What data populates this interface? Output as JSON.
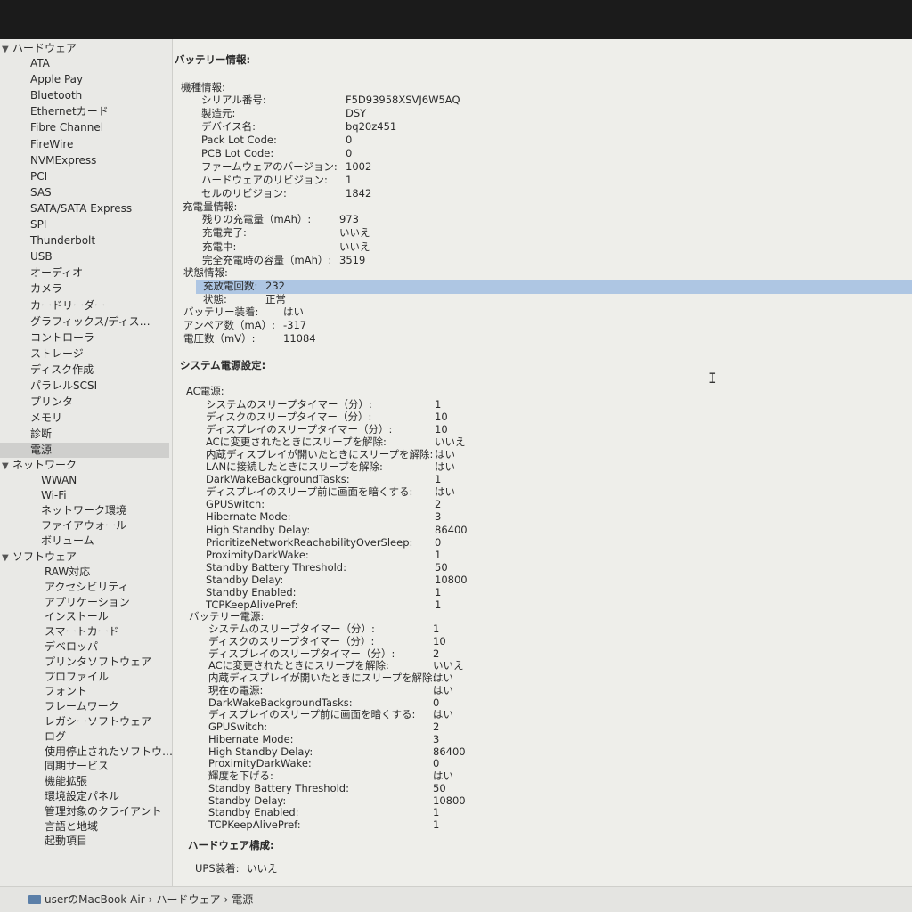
{
  "sidebar": {
    "groups": [
      {
        "label": "ハードウェア",
        "items": [
          "ATA",
          "Apple Pay",
          "Bluetooth",
          "Ethernetカード",
          "Fibre Channel",
          "FireWire",
          "NVMExpress",
          "PCI",
          "SAS",
          "SATA/SATA Express",
          "SPI",
          "Thunderbolt",
          "USB",
          "オーディオ",
          "カメラ",
          "カードリーダー",
          "グラフィックス/ディス…",
          "コントローラ",
          "ストレージ",
          "ディスク作成",
          "パラレルSCSI",
          "プリンタ",
          "メモリ",
          "診断",
          "電源"
        ]
      },
      {
        "label": "ネットワーク",
        "items": [
          "WWAN",
          "Wi-Fi",
          "ネットワーク環境",
          "ファイアウォール",
          "ボリューム"
        ]
      },
      {
        "label": "ソフトウェア",
        "items": [
          "RAW対応",
          "アクセシビリティ",
          "アプリケーション",
          "インストール",
          "スマートカード",
          "デベロッパ",
          "プリンタソフトウェア",
          "プロファイル",
          "フォント",
          "フレームワーク",
          "レガシーソフトウェア",
          "ログ",
          "使用停止されたソフトウ…",
          "同期サービス",
          "機能拡張",
          "環境設定パネル",
          "管理対象のクライアント",
          "言語と地域",
          "起動項目"
        ]
      }
    ],
    "selected": "電源"
  },
  "battery": {
    "title": "バッテリー情報:",
    "model_header": "機種情報:",
    "model": [
      {
        "k": "シリアル番号:",
        "v": "F5D93958XSVJ6W5AQ"
      },
      {
        "k": "製造元:",
        "v": "DSY"
      },
      {
        "k": "デバイス名:",
        "v": "bq20z451"
      },
      {
        "k": "Pack Lot Code:",
        "v": "0"
      },
      {
        "k": "PCB Lot Code:",
        "v": "0"
      },
      {
        "k": "ファームウェアのバージョン:",
        "v": "1002"
      },
      {
        "k": "ハードウェアのリビジョン:",
        "v": "1"
      },
      {
        "k": "セルのリビジョン:",
        "v": "1842"
      }
    ],
    "charge_header": "充電量情報:",
    "charge": [
      {
        "k": "残りの充電量（mAh）:",
        "v": "973"
      },
      {
        "k": "充電完了:",
        "v": "いいえ"
      },
      {
        "k": "充電中:",
        "v": "いいえ"
      },
      {
        "k": "完全充電時の容量（mAh）:",
        "v": "3519"
      }
    ],
    "health_header": "状態情報:",
    "health": [
      {
        "k": "充放電回数:",
        "v": "232"
      },
      {
        "k": "状態:",
        "v": "正常"
      }
    ],
    "misc": [
      {
        "k": "バッテリー装着:",
        "v": "はい"
      },
      {
        "k": "アンペア数（mA）:",
        "v": "-317"
      },
      {
        "k": "電圧数（mV）:",
        "v": "11084"
      }
    ]
  },
  "power": {
    "title": "システム電源設定:",
    "ac_header": "AC電源:",
    "ac": [
      {
        "k": "システムのスリープタイマー（分）:",
        "v": "1"
      },
      {
        "k": "ディスクのスリープタイマー（分）:",
        "v": "10"
      },
      {
        "k": "ディスプレイのスリープタイマー（分）:",
        "v": "10"
      },
      {
        "k": "ACに変更されたときにスリープを解除:",
        "v": "いいえ"
      },
      {
        "k": "内蔵ディスプレイが開いたときにスリープを解除:",
        "v": "はい"
      },
      {
        "k": "LANに接続したときにスリープを解除:",
        "v": "はい"
      },
      {
        "k": "DarkWakeBackgroundTasks:",
        "v": "1"
      },
      {
        "k": "ディスプレイのスリープ前に画面を暗くする:",
        "v": "はい"
      },
      {
        "k": "GPUSwitch:",
        "v": "2"
      },
      {
        "k": "Hibernate Mode:",
        "v": "3"
      },
      {
        "k": "High Standby Delay:",
        "v": "86400"
      },
      {
        "k": "PrioritizeNetworkReachabilityOverSleep:",
        "v": "0"
      },
      {
        "k": "ProximityDarkWake:",
        "v": "1"
      },
      {
        "k": "Standby Battery Threshold:",
        "v": "50"
      },
      {
        "k": "Standby Delay:",
        "v": "10800"
      },
      {
        "k": "Standby Enabled:",
        "v": "1"
      },
      {
        "k": "TCPKeepAlivePref:",
        "v": "1"
      }
    ],
    "battery_header": "バッテリー電源:",
    "battery": [
      {
        "k": "システムのスリープタイマー（分）:",
        "v": "1"
      },
      {
        "k": "ディスクのスリープタイマー（分）:",
        "v": "10"
      },
      {
        "k": "ディスプレイのスリープタイマー（分）:",
        "v": "2"
      },
      {
        "k": "ACに変更されたときにスリープを解除:",
        "v": "いいえ"
      },
      {
        "k": "内蔵ディスプレイが開いたときにスリープを解除:",
        "v": "はい"
      },
      {
        "k": "現在の電源:",
        "v": "はい"
      },
      {
        "k": "DarkWakeBackgroundTasks:",
        "v": "0"
      },
      {
        "k": "ディスプレイのスリープ前に画面を暗くする:",
        "v": "はい"
      },
      {
        "k": "GPUSwitch:",
        "v": "2"
      },
      {
        "k": "Hibernate Mode:",
        "v": "3"
      },
      {
        "k": "High Standby Delay:",
        "v": "86400"
      },
      {
        "k": "ProximityDarkWake:",
        "v": "0"
      },
      {
        "k": "輝度を下げる:",
        "v": "はい"
      },
      {
        "k": "Standby Battery Threshold:",
        "v": "50"
      },
      {
        "k": "Standby Delay:",
        "v": "10800"
      },
      {
        "k": "Standby Enabled:",
        "v": "1"
      },
      {
        "k": "TCPKeepAlivePref:",
        "v": "1"
      }
    ]
  },
  "hardware_config": {
    "title": "ハードウェア構成:",
    "ups_label": "UPS装着:",
    "ups_value": "いいえ"
  },
  "statusbar": {
    "path": [
      "userのMacBook Air",
      "ハードウェア",
      "電源"
    ],
    "separator": "›"
  },
  "colors": {
    "highlight": "#aec6e3",
    "sidebar_selected": "#cfcfcd"
  }
}
